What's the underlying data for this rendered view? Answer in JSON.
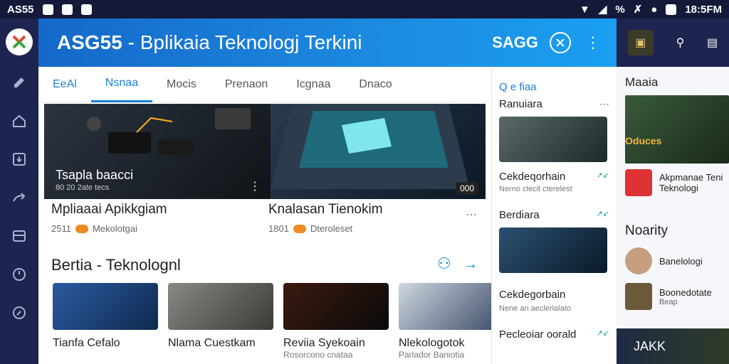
{
  "status": {
    "left_label": "AS55",
    "time": "18:5FM",
    "battery": "%"
  },
  "app": {
    "title_bold": "ASG55",
    "title_rest": " - Bplikaia Teknologj Terkini",
    "brand": "SAGG"
  },
  "tabs": [
    "EeAl",
    "Nsnaa",
    "Mocis",
    "Prenaon",
    "Icgnaa",
    "Dnaco"
  ],
  "hero": {
    "left_caption": "Tsapla baacci",
    "left_sub": "80 20 2ate tecs",
    "right_badge": "000",
    "colors": {
      "left": "#1f2a33",
      "right": "#13283b"
    }
  },
  "feature_cards": [
    {
      "title": "Mpliaaai Apikkgiam",
      "meta_num": "2511",
      "meta_text": "Mekolotgai"
    },
    {
      "title": "Knalasan Tienokim",
      "meta_num": "1801",
      "meta_text": "Dteroleset"
    }
  ],
  "section": {
    "title": "Bertia - Teknolognl"
  },
  "grid": [
    {
      "title": "Tianfa Cefalo",
      "sub": "",
      "color": "#2a5aa0"
    },
    {
      "title": "Nlama Cuestkam",
      "sub": "",
      "color": "#6a6a66"
    },
    {
      "title": "Reviia Syekoain",
      "sub": "Rosorcono cnataa",
      "color": "#1b1b1b"
    },
    {
      "title": "Nlekologotok",
      "sub": "Parlador Baniotia",
      "color": "#5a7ca8"
    }
  ],
  "side_column": {
    "top_icons": "Q  e     fiaa",
    "items": [
      {
        "head": "Ranuiara",
        "title": "Cekdeqorhain",
        "sub": "Nerno clecit cterelest",
        "tag": "↗↙",
        "color": "#3a4a4a"
      },
      {
        "head": "Berdiara",
        "title": "Cekdegorbain",
        "sub": "Nene an aeclerlalato",
        "tag": "↗↙",
        "color": "#1f3850"
      },
      {
        "head": "",
        "title": "Pecleoiar oorald",
        "sub": "",
        "tag": "↗↙",
        "color": ""
      }
    ]
  },
  "right_panel": {
    "label1": "Maaia",
    "badge": "Oduces",
    "item1_title": "Akpmanae Teni",
    "item1_sub": "Teknologi",
    "label2": "Noarity",
    "list": [
      {
        "title": "Banelologi",
        "sub": ""
      },
      {
        "title": "Boonedotate",
        "sub": "Beap"
      }
    ],
    "footer": "JAKK"
  }
}
